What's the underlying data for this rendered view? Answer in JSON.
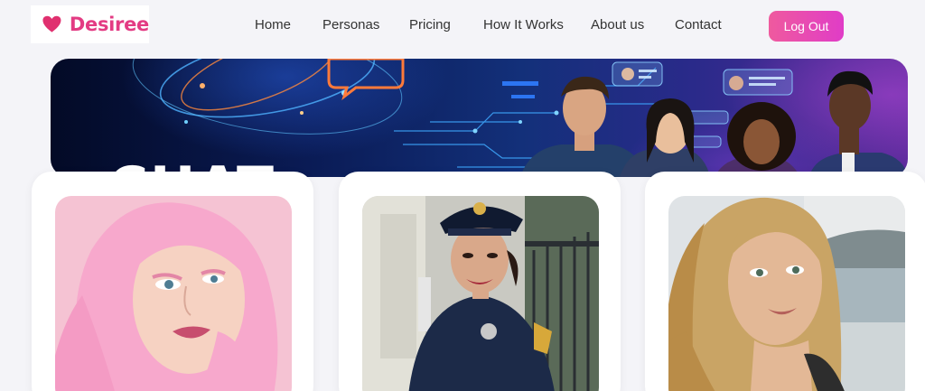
{
  "brand": {
    "name": "Desiree",
    "logo_icon": "heart-icon",
    "accent": "#e33b83"
  },
  "nav": {
    "items": [
      {
        "label": "Home"
      },
      {
        "label": "Personas"
      },
      {
        "label": "Pricing"
      },
      {
        "label": "How It Works"
      },
      {
        "label": "About us"
      },
      {
        "label": "Contact"
      }
    ],
    "logout_label": "Log Out",
    "logout_gradient": [
      "#ef5a9e",
      "#e03cc7"
    ]
  },
  "banner": {
    "overlay_text": "CHAT"
  },
  "personas": [
    {
      "image": "pink-haired-woman-portrait"
    },
    {
      "image": "police-officer-woman-portrait"
    },
    {
      "image": "blonde-woman-beach-portrait"
    }
  ]
}
